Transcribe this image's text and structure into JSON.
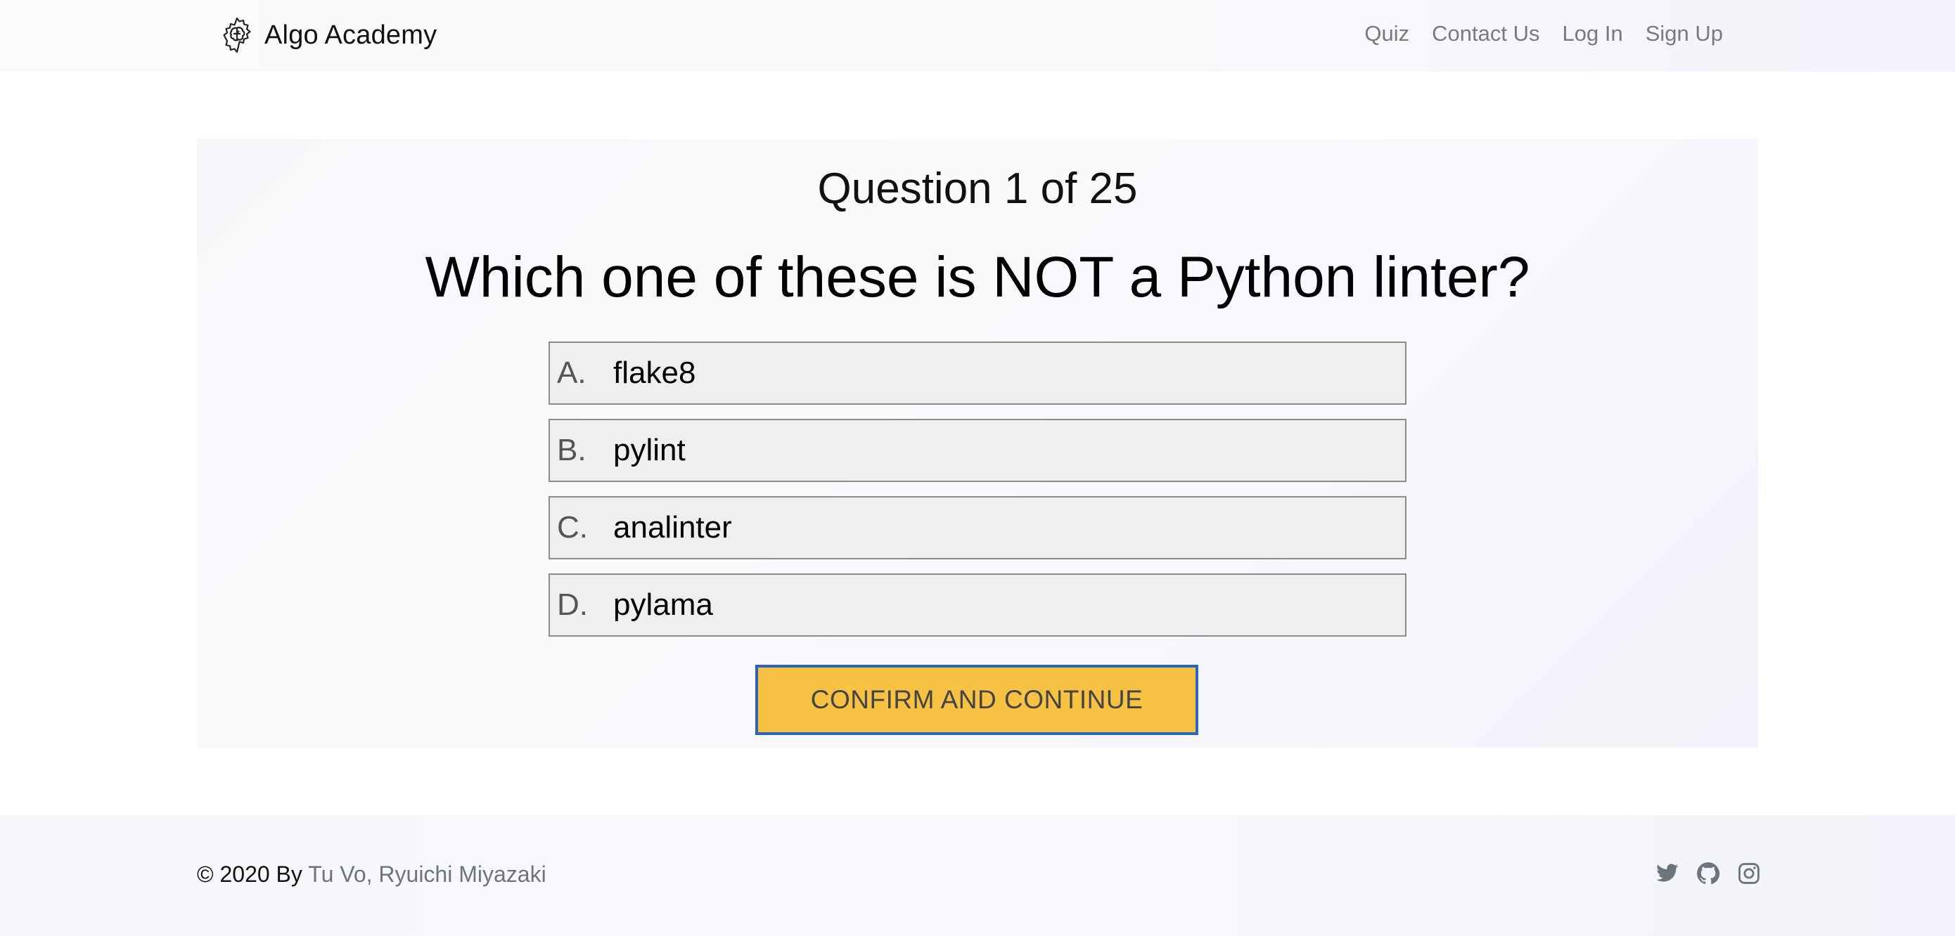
{
  "navbar": {
    "brand": "Algo Academy",
    "brand_icon": "brain-gear-icon",
    "links": [
      "Quiz",
      "Contact Us",
      "Log In",
      "Sign Up"
    ]
  },
  "quiz": {
    "counter": "Question 1 of 25",
    "question": "Which one of these is NOT a Python linter?",
    "options": [
      {
        "letter": "A.",
        "text": "flake8"
      },
      {
        "letter": "B.",
        "text": "pylint"
      },
      {
        "letter": "C.",
        "text": "analinter"
      },
      {
        "letter": "D.",
        "text": "pylama"
      }
    ],
    "confirm_label": "CONFIRM AND CONTINUE"
  },
  "footer": {
    "copyright_prefix": "© 2020 By ",
    "authors": "Tu Vo, Ryuichi Miyazaki",
    "social_icons": [
      "twitter-icon",
      "github-icon",
      "instagram-icon"
    ]
  },
  "colors": {
    "accent_button": "#f7c244",
    "button_border": "#2b64b8",
    "option_bg": "#efefef",
    "muted_text": "#7a7a7a"
  }
}
